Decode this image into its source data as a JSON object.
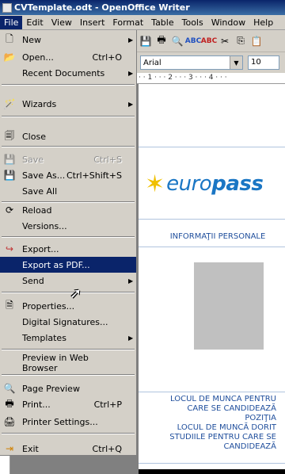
{
  "window": {
    "title": "CVTemplate.odt - OpenOffice Writer"
  },
  "menubar": [
    "File",
    "Edit",
    "View",
    "Insert",
    "Format",
    "Table",
    "Tools",
    "Window",
    "Help"
  ],
  "toolbar": {
    "font_name": "Arial",
    "font_size": "10"
  },
  "ruler": {
    "text": "· · 1 · · · 2 · · · 3 · · · 4 · · ·"
  },
  "file_menu": [
    {
      "label": "New",
      "icon": "new-document-icon",
      "shortcut": "",
      "submenu": true,
      "state": "normal"
    },
    {
      "label": "Open...",
      "icon": "open-folder-icon",
      "shortcut": "Ctrl+O",
      "submenu": false,
      "state": "normal"
    },
    {
      "label": "Recent Documents",
      "icon": "",
      "shortcut": "",
      "submenu": true,
      "state": "normal"
    },
    {
      "label": "Wizards",
      "icon": "wizard-icon",
      "shortcut": "",
      "submenu": true,
      "state": "normal"
    },
    {
      "label": "Close",
      "icon": "close-document-icon",
      "shortcut": "",
      "submenu": false,
      "state": "normal"
    },
    {
      "label": "Save",
      "icon": "save-icon",
      "shortcut": "Ctrl+S",
      "submenu": false,
      "state": "disabled"
    },
    {
      "label": "Save As...",
      "icon": "save-as-icon",
      "shortcut": "Ctrl+Shift+S",
      "submenu": false,
      "state": "normal"
    },
    {
      "label": "Save All",
      "icon": "",
      "shortcut": "",
      "submenu": false,
      "state": "normal"
    },
    {
      "label": "Reload",
      "icon": "reload-icon",
      "shortcut": "",
      "submenu": false,
      "state": "normal"
    },
    {
      "label": "Versions...",
      "icon": "",
      "shortcut": "",
      "submenu": false,
      "state": "normal"
    },
    {
      "label": "Export...",
      "icon": "export-icon",
      "shortcut": "",
      "submenu": false,
      "state": "normal"
    },
    {
      "label": "Export as PDF...",
      "icon": "",
      "shortcut": "",
      "submenu": false,
      "state": "highlighted"
    },
    {
      "label": "Send",
      "icon": "",
      "shortcut": "",
      "submenu": true,
      "state": "normal"
    },
    {
      "label": "Properties...",
      "icon": "properties-icon",
      "shortcut": "",
      "submenu": false,
      "state": "normal"
    },
    {
      "label": "Digital Signatures...",
      "icon": "",
      "shortcut": "",
      "submenu": false,
      "state": "normal"
    },
    {
      "label": "Templates",
      "icon": "",
      "shortcut": "",
      "submenu": true,
      "state": "normal"
    },
    {
      "label": "Preview in Web Browser",
      "icon": "",
      "shortcut": "",
      "submenu": false,
      "state": "normal"
    },
    {
      "label": "Page Preview",
      "icon": "page-preview-icon",
      "shortcut": "",
      "submenu": false,
      "state": "normal"
    },
    {
      "label": "Print...",
      "icon": "print-icon",
      "shortcut": "Ctrl+P",
      "submenu": false,
      "state": "normal"
    },
    {
      "label": "Printer Settings...",
      "icon": "printer-settings-icon",
      "shortcut": "",
      "submenu": false,
      "state": "normal"
    },
    {
      "label": "Exit",
      "icon": "exit-icon",
      "shortcut": "Ctrl+Q",
      "submenu": false,
      "state": "normal"
    }
  ],
  "document": {
    "logo_text_1": "euro",
    "logo_text_2": "pass",
    "heading": "INFORMAŢII PERSONALE",
    "job_lines": [
      "LOCUL DE MUNCA PENTRU",
      "CARE SE CANDIDEAZĂ",
      "POZIŢIA",
      "LOCUL DE MUNCĂ DORIT",
      "STUDIILE PENTRU CARE SE",
      "CANDIDEAZĂ"
    ]
  },
  "colors": {
    "highlight": "#0a246a",
    "menu_bg": "#d4d0c8",
    "doc_text": "#1f4e9c"
  }
}
